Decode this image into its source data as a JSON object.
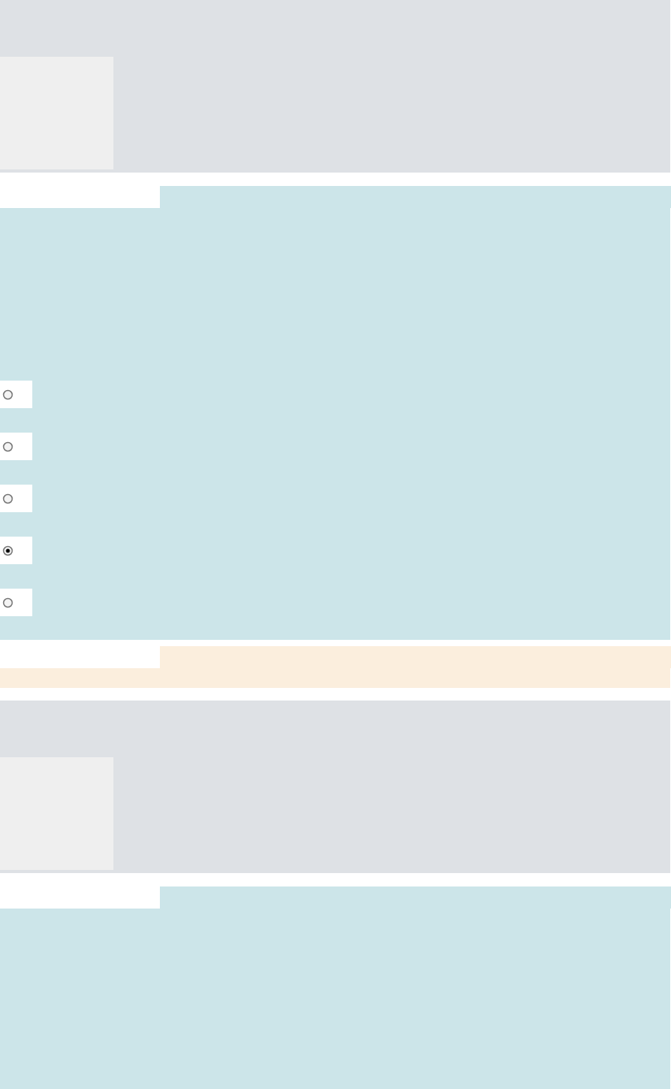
{
  "sections": [
    {
      "kind": "header"
    },
    {
      "kind": "question",
      "options": [
        {
          "selected": false
        },
        {
          "selected": false
        },
        {
          "selected": false
        },
        {
          "selected": true
        },
        {
          "selected": false
        }
      ]
    },
    {
      "kind": "feedback"
    },
    {
      "kind": "header"
    },
    {
      "kind": "question"
    }
  ]
}
